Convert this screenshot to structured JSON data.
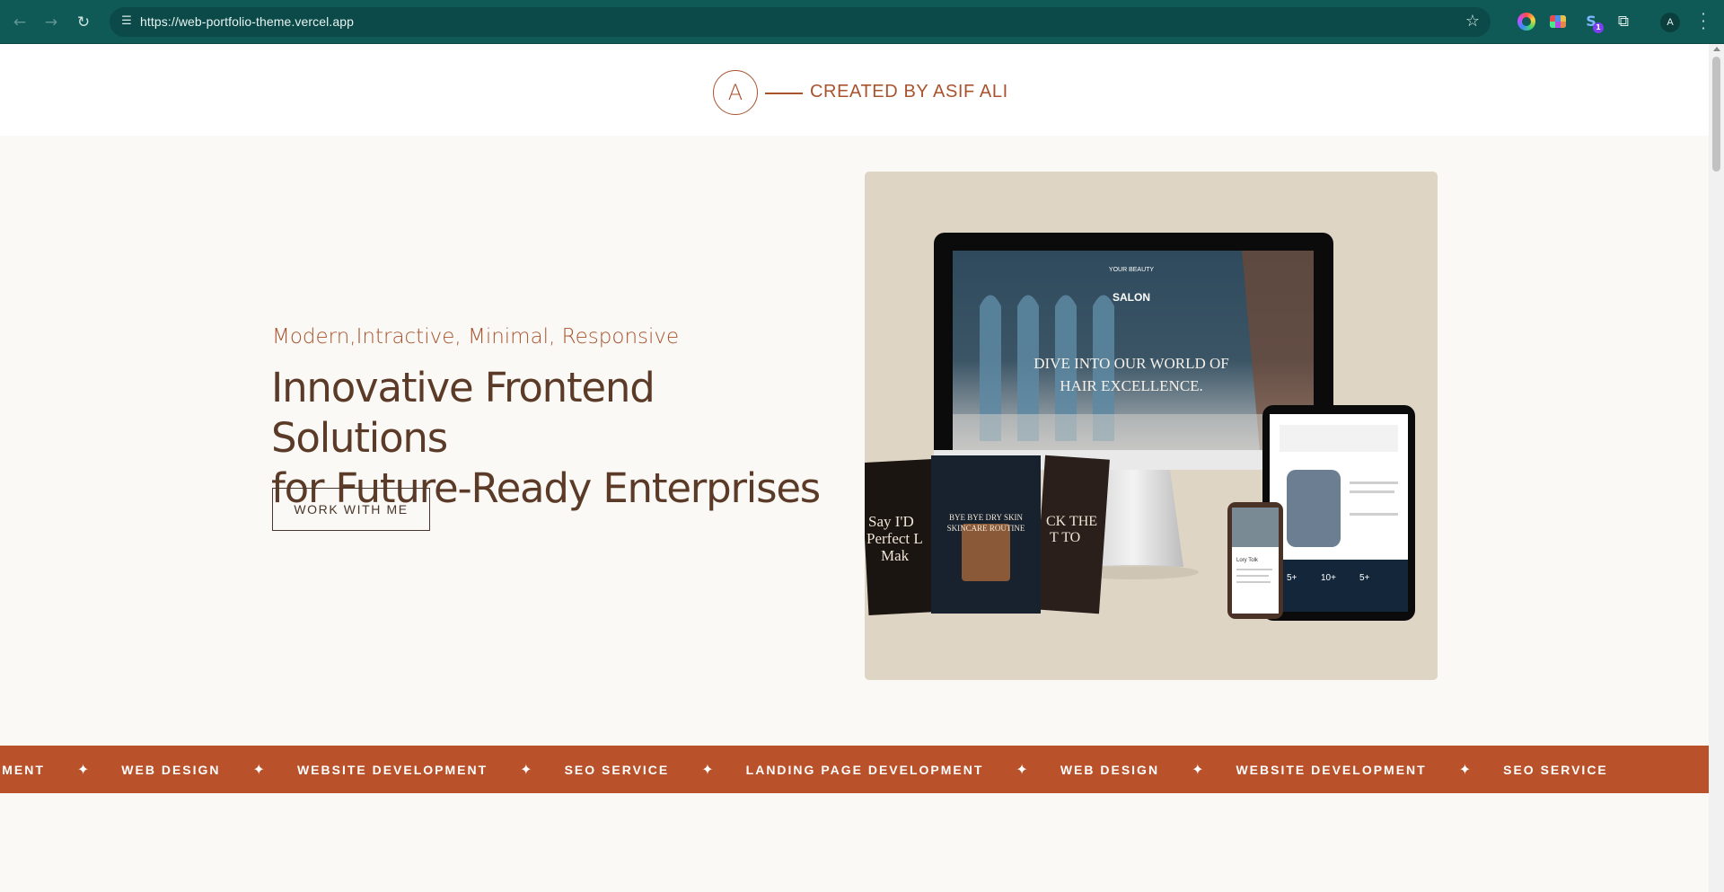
{
  "browser": {
    "url": "https://web-portfolio-theme.vercel.app",
    "profile_initial": "A",
    "extension_badge": "1",
    "extension_letter": "S",
    "icons": {
      "back": "arrow-left-icon",
      "forward": "arrow-right-icon",
      "reload": "reload-icon",
      "site_info": "tune-icon",
      "bookmark": "star-icon",
      "extensions": "puzzle-icon",
      "menu": "kebab-menu-icon"
    }
  },
  "header": {
    "logo_letter": "A",
    "credit": "CREATED BY ASIF ALI"
  },
  "hero": {
    "tagline": "Modern,Intractive, Minimal, Responsive",
    "headline_line1": "Innovative Frontend Solutions",
    "headline_line2": "for Future-Ready Enterprises",
    "cta": "WORK WITH ME"
  },
  "mockup": {
    "brand_top": "YOUR BEAUTY",
    "brand": "SALON",
    "screen_headline_1": "DIVE INTO OUR WORLD OF",
    "screen_headline_2": "HAIR EXCELLENCE.",
    "card1_text_1": "Say I'D",
    "card1_text_2": "Perfect L",
    "card1_text_3": "Mak",
    "card2_text_1": "BYE BYE DRY SKIN",
    "card2_text_2": "SKINCARE ROUTINE",
    "card3_text_1": "CK THE",
    "card3_text_2": "T TO",
    "phone_title": "Lory Tolk",
    "tablet_stat_1": "5+",
    "tablet_stat_2": "10+",
    "tablet_stat_3": "5+",
    "colors": {
      "background": "#ded5c4",
      "salon_dark": "#0f1d2a"
    }
  },
  "marquee": {
    "items": [
      "OPMENT",
      "WEB DESIGN",
      "WEBSITE DEVELOPMENT",
      "SEO SERVICE",
      "LANDING PAGE DEVELOPMENT",
      "WEB DESIGN",
      "WEBSITE DEVELOPMENT",
      "SEO SERVICE"
    ],
    "separator": "✦",
    "color": "#b9512a"
  },
  "theme": {
    "accent": "#a8532e",
    "heading": "#5b3b28",
    "chrome": "#0f5a57"
  }
}
